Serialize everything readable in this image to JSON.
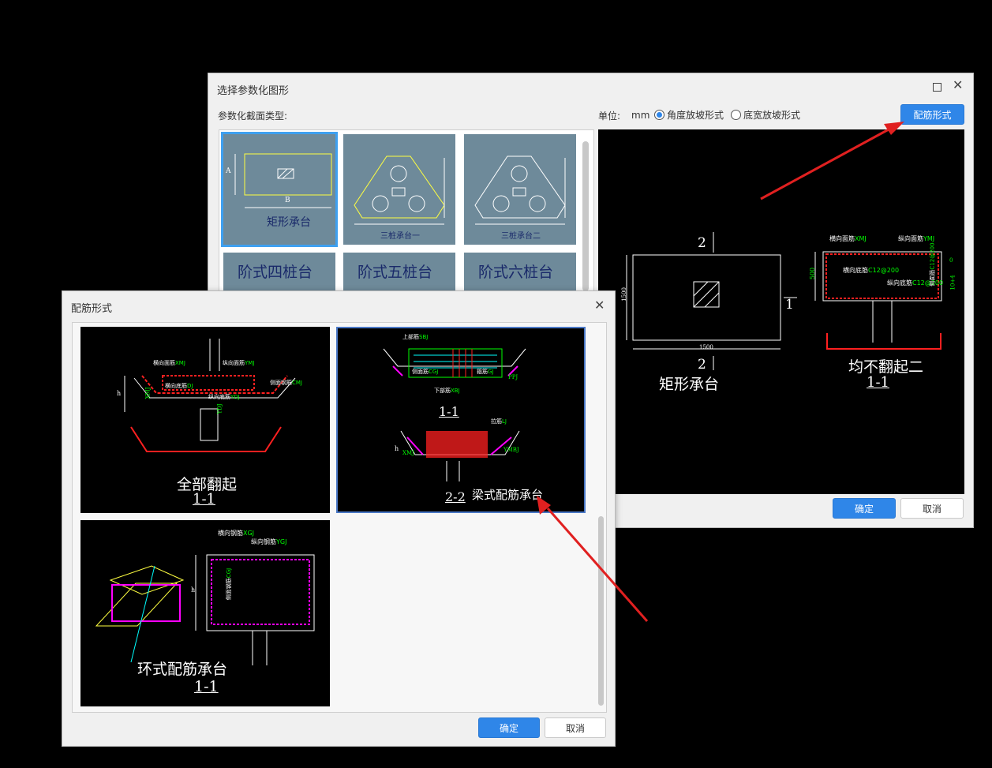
{
  "main_dialog": {
    "title": "选择参数化图形",
    "section_label": "参数化截面类型:",
    "unit_label": "单位:",
    "unit_value": "mm",
    "radio_angle": "角度放坡形式",
    "radio_width": "底宽放坡形式",
    "rebar_button": "配筋形式",
    "ok": "确定",
    "cancel": "取消",
    "tiles": [
      {
        "label": "矩形承台",
        "sub_a": "A",
        "sub_b": "B"
      },
      {
        "label": "三桩承台一"
      },
      {
        "label": "三桩承台二"
      },
      {
        "label": "阶式四桩台"
      },
      {
        "label": "阶式五桩台"
      },
      {
        "label": "阶式六桩台"
      }
    ],
    "preview": {
      "left_title": "矩形承台",
      "left_dim_top": "1500",
      "left_dim_left": "1500",
      "sec_top": "2",
      "sec_bottom": "2",
      "sec_right": "1",
      "right_title": "均不翻起二",
      "right_section": "1-1",
      "right_dim_h": "500",
      "lbl_h_face": "横向面筋",
      "lbl_h_face_code": "XMJ",
      "lbl_v_face": "纵向面筋",
      "lbl_v_face_code": "YMJ",
      "lbl_h_bottom": "横向底筋",
      "lbl_h_bottom_code": "C12@200",
      "lbl_v_bottom": "纵向底筋",
      "lbl_v_bottom_code": "C12@200",
      "lbl_side": "侧面筋",
      "lbl_side_code": "C12@200",
      "lbl_side2": "10+4",
      "lbl_side3": "0"
    }
  },
  "rebar_dialog": {
    "title": "配筋形式",
    "ok": "确定",
    "cancel": "取消",
    "options": [
      {
        "title": "全部翻起",
        "section": "1-1",
        "h_face": "横向面筋",
        "h_face_code": "XMJ",
        "v_face": "纵向面筋",
        "v_face_code": "YMJ",
        "h_bottom": "横向底筋",
        "h_bottom_code": "DJ",
        "v_bottom": "纵向底筋",
        "v_bottom_code": "YDJ",
        "side": "侧面钢筋",
        "side_code": "CMJ",
        "left_code": "XMJ",
        "left_code2": "YDJ",
        "dim": "h"
      },
      {
        "title": "梁式配筋承台",
        "section1": "1-1",
        "section2": "2-2",
        "top": "上部筋",
        "top_code": "SBJ",
        "side": "侧面筋",
        "side_code": "CGJ",
        "stirrup": "箍筋",
        "stirrup_code": "GJ",
        "bottom": "下部筋",
        "bottom_code": "XBJ",
        "pile": "拉筋",
        "pile_code": "LJ",
        "h_code": "XMJ",
        "v_code": "YMBJ",
        "pp_code": "PPJ",
        "dim": "h"
      },
      {
        "title": "环式配筋承台",
        "section": "1-1",
        "h_rebar": "横向钢筋",
        "h_rebar_code": "XGJ",
        "v_rebar": "纵向钢筋",
        "v_rebar_code": "YGJ",
        "side": "侧面钢筋",
        "side_code": "CGJ",
        "dim": "h"
      }
    ]
  },
  "colors": {
    "accent": "#2f86e8",
    "tile_bg": "#6e8a9a",
    "arrow": "#e02020"
  }
}
